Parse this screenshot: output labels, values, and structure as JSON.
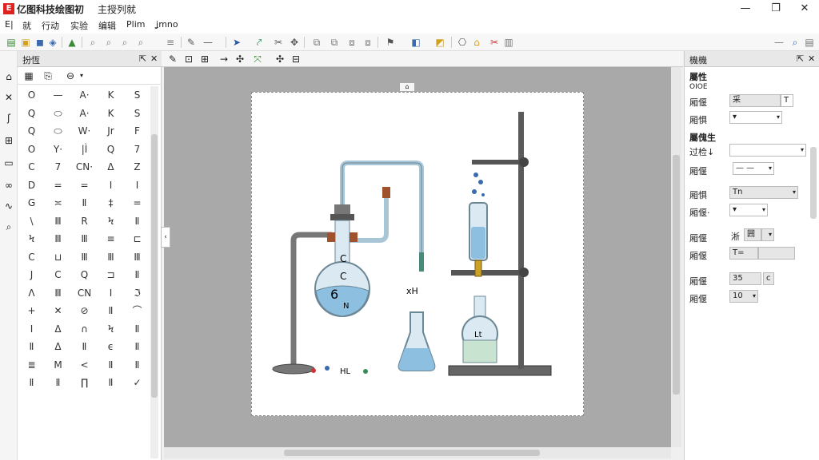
{
  "titlebar": {
    "app_title": "亿图科技绘图初",
    "doc_title": "主授列就",
    "minimize": "—",
    "maximize": "❐",
    "close": "✕"
  },
  "menubar": {
    "items": [
      "E|",
      "就",
      "行动",
      "实验",
      "编辑",
      "Plim",
      "ʝmno"
    ]
  },
  "symbol_panel": {
    "title": "扮恆",
    "close": "✕",
    "cells": [
      "O",
      "—",
      "A·",
      "K",
      "S",
      "Q",
      "⬭",
      "A·",
      "K",
      "S",
      "Q",
      "⬭",
      "W·",
      "Jr",
      "F",
      "O",
      "Y·",
      "|Ì",
      "Q",
      "7",
      "C",
      "7",
      "CN·",
      "Δ",
      "Z",
      "D",
      "=",
      "=",
      "Ⅰ",
      "I",
      "G",
      "≍",
      "Ⅱ",
      "‡",
      "=",
      "\\",
      "Ⅲ",
      "R",
      "Ϟ",
      "Ⅱ",
      "Ϟ",
      "Ⅲ",
      "Ⅲ",
      "≡",
      "⊏",
      "C",
      "⊔",
      "Ⅲ",
      "Ⅲ",
      "Ⅲ",
      "J",
      "C",
      "Q",
      "⊐",
      "Ⅱ",
      "Λ",
      "Ⅲ",
      "CN",
      "Ⅰ",
      "ℑ",
      "+",
      "✕",
      "⊘",
      "Ⅱ",
      "⌒",
      "Ⅰ",
      "Δ",
      "∩",
      "Ϟ",
      "Ⅱ",
      "Ⅱ",
      "Δ",
      "Ⅱ",
      "ϵ",
      "Ⅱ",
      "≣",
      "M",
      "<",
      "Ⅱ",
      "Ⅱ",
      "Ⅱ",
      "Ⅱ",
      "∏",
      "Ⅱ",
      "✓"
    ]
  },
  "canvas": {
    "diagram_labels": {
      "flask_c1": "C",
      "flask_c2": "C",
      "flask_script": "6",
      "flask_n": "N",
      "xh": "xH",
      "hl": "HL",
      "lt": "Lt"
    }
  },
  "properties": {
    "title": "機機",
    "close": "✕",
    "section1": "屬性",
    "section1_sub": "OIOE",
    "row1_label": "厢偃",
    "row1_value": "采",
    "row2_label": "厢惧",
    "row2_value": "▾",
    "section2": "屬傀生",
    "row3_label": "过检↓",
    "row3_value": "",
    "row4_label": "厢偃",
    "row4_value": "— —",
    "row5_label": "厢惧",
    "row5_value": "Tn",
    "row6_label": "厢偃·",
    "row6_value": "▾",
    "row7_label": "厢偃",
    "row7_value_a": "淅",
    "row7_value_b": "囲",
    "row8_label": "厢偃",
    "row8_value": "T=",
    "row9_label": "厢偃",
    "row9_value": "35",
    "row10_label": "厢偃",
    "row10_value": "10"
  },
  "colors": {
    "canvas_bg": "#a9a9a9",
    "glass": "#bcd9ea",
    "liquid_blue": "#8dbfe0",
    "liquid_green": "#c8e3d0",
    "stand": "#5a5a5a"
  }
}
